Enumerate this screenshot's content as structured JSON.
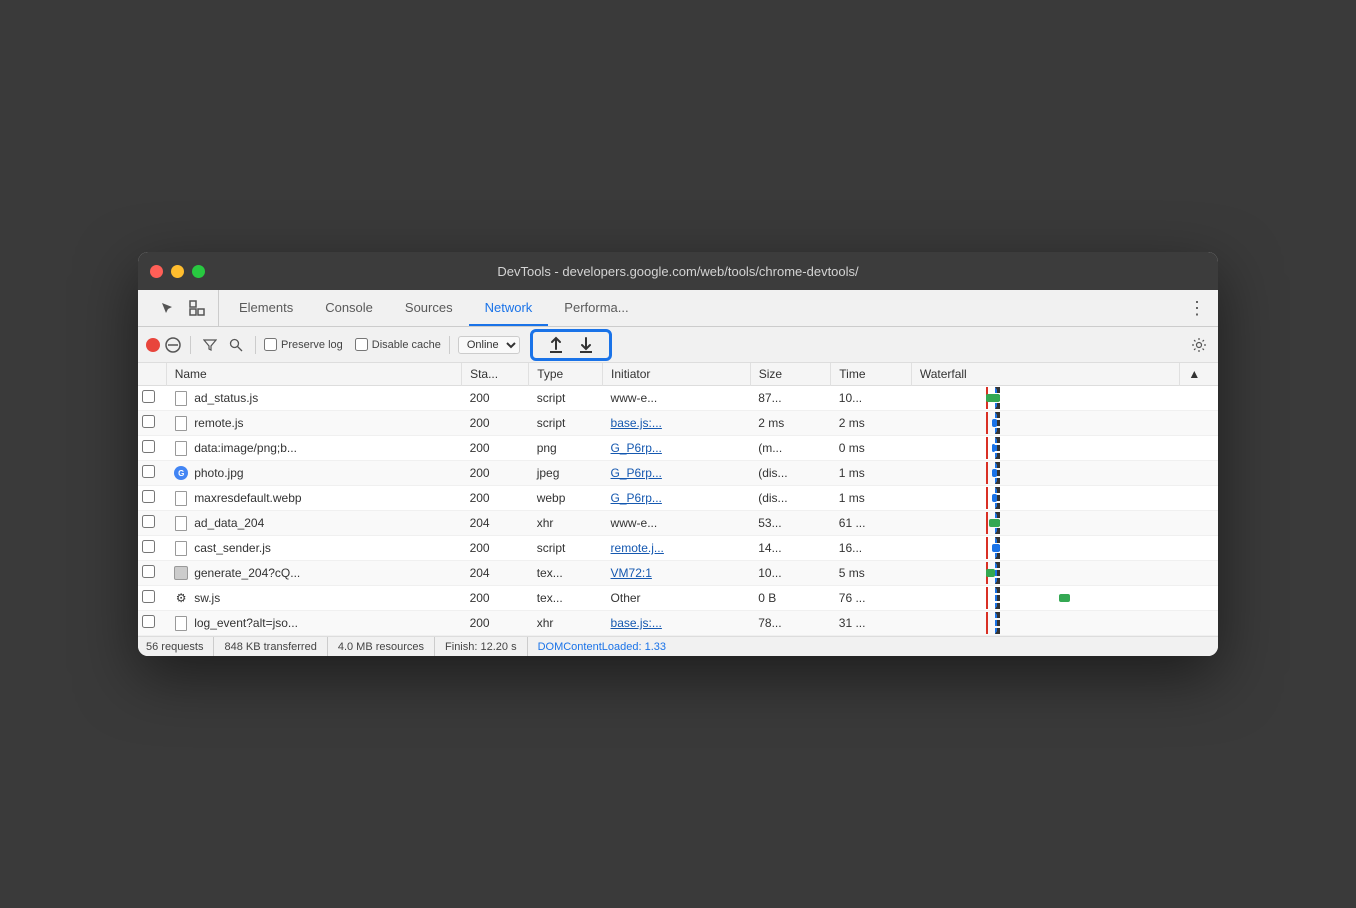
{
  "window": {
    "title": "DevTools - developers.google.com/web/tools/chrome-devtools/"
  },
  "tabs": [
    {
      "id": "elements",
      "label": "Elements",
      "active": false
    },
    {
      "id": "console",
      "label": "Console",
      "active": false
    },
    {
      "id": "sources",
      "label": "Sources",
      "active": false
    },
    {
      "id": "network",
      "label": "Network",
      "active": true
    },
    {
      "id": "performance",
      "label": "Performa...",
      "active": false
    }
  ],
  "toolbar": {
    "preserve_log_label": "Preserve log",
    "disable_cache_label": "Disable cache",
    "online_label": "Online",
    "upload_label": "upload",
    "download_label": "download"
  },
  "table": {
    "columns": [
      "",
      "Name",
      "Sta...",
      "Type",
      "Initiator",
      "Size",
      "Time",
      "Waterfall",
      "▲"
    ],
    "rows": [
      {
        "name": "ad_status.js",
        "status": "200",
        "type": "script",
        "initiator": "www-e...",
        "size": "87...",
        "time": "10...",
        "icon": "default"
      },
      {
        "name": "remote.js",
        "status": "200",
        "type": "script",
        "initiator": "base.js:...",
        "size": "2 ms",
        "time": "2 ms",
        "icon": "default",
        "initiator_is_link": true
      },
      {
        "name": "data:image/png;b...",
        "status": "200",
        "type": "png",
        "initiator": "G_P6rp...",
        "size": "(m...",
        "time": "0 ms",
        "icon": "default",
        "initiator_is_link": true
      },
      {
        "name": "photo.jpg",
        "status": "200",
        "type": "jpeg",
        "initiator": "G_P6rp...",
        "size": "(dis...",
        "time": "1 ms",
        "icon": "chrome",
        "initiator_is_link": true
      },
      {
        "name": "maxresdefault.webp",
        "status": "200",
        "type": "webp",
        "initiator": "G_P6rp...",
        "size": "(dis...",
        "time": "1 ms",
        "icon": "default",
        "initiator_is_link": true
      },
      {
        "name": "ad_data_204",
        "status": "204",
        "type": "xhr",
        "initiator": "www-e...",
        "size": "53...",
        "time": "61 ...",
        "icon": "default"
      },
      {
        "name": "cast_sender.js",
        "status": "200",
        "type": "script",
        "initiator": "remote.j...",
        "size": "14...",
        "time": "16...",
        "icon": "default",
        "initiator_is_link": true
      },
      {
        "name": "generate_204?cQ...",
        "status": "204",
        "type": "tex...",
        "initiator": "VM72:1",
        "size": "10...",
        "time": "5 ms",
        "icon": "special",
        "initiator_is_link": true
      },
      {
        "name": "sw.js",
        "status": "200",
        "type": "tex...",
        "initiator": "Other",
        "size": "0 B",
        "time": "76 ...",
        "icon": "gear"
      },
      {
        "name": "log_event?alt=jso...",
        "status": "200",
        "type": "xhr",
        "initiator": "base.js:...",
        "size": "78...",
        "time": "31 ...",
        "icon": "default",
        "initiator_is_link": true
      }
    ]
  },
  "status_bar": {
    "requests": "56 requests",
    "transferred": "848 KB transferred",
    "resources": "4.0 MB resources",
    "finish": "Finish: 12.20 s",
    "dom_content": "DOMContentLoaded: 1.33"
  }
}
